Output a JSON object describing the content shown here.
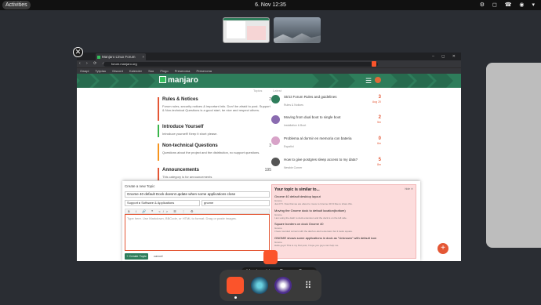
{
  "topbar": {
    "activities": "Activities",
    "clock": "6. Nov  12:35",
    "tray": "⚙ ◻ ☎ ◉ ▾"
  },
  "browser": {
    "tab_title": "Manjaro Linux Forum",
    "tab_close": "×",
    "url": "forum.manjaro.org",
    "nav_icons": "‹ › ⟳ ⌂",
    "window_controls": "– ◻ ✕",
    "bookmarks": [
      "Owapi",
      "Tylydau",
      "Discord",
      "Kalender",
      "Soo",
      "Pingo",
      "Preseroma",
      "Preseroma"
    ]
  },
  "forum": {
    "logo": "manjaro",
    "hamburger": "☰",
    "col_topics": "Topics",
    "col_latest": "Latest",
    "categories": [
      {
        "title": "Rules & Notices",
        "desc": "Forum rules, security notices & important info. Don't be afraid to post. Support & Non-technical Questions is a good start, be nice and respect others.",
        "count": "2",
        "color": "#e45735"
      },
      {
        "title": "Introduce Yourself",
        "desc": "Introduce yourself! Keep it short please.",
        "count": "",
        "color": "#3ab54a"
      },
      {
        "title": "Non-technical Questions",
        "desc": "Questions about the project and the distribution, no support questions.",
        "count": "3",
        "color": "#f7941d"
      },
      {
        "title": "Announcements",
        "desc": "This category is for announcements",
        "count": "195",
        "color": "#e45735"
      }
    ],
    "latest": [
      {
        "title": "Strict Forum Rules and guidelines",
        "cat": "Rules & Notices",
        "replies": "3",
        "age": "Aug 20",
        "avatar": "#2e7d5b"
      },
      {
        "title": "Moving from dual boot to single boot",
        "cat": "Installation & Boot",
        "replies": "2",
        "age": "5m",
        "avatar": "#8a6bb0"
      },
      {
        "title": "Problema al dormir en memoria con bateria",
        "cat": "Español",
        "replies": "0",
        "age": "6m",
        "avatar": "#d8a3c8"
      },
      {
        "title": "How to give postgres sleep access to my data?",
        "cat": "Newbie Corner",
        "replies": "5",
        "age": "8m",
        "avatar": "#555555"
      }
    ]
  },
  "composer": {
    "header": "Create a new Topic",
    "title_value": "Gnome 40 default Dock doesnt update when some applications close",
    "category": "Support  ▸ Software & Applications",
    "tag": "gnome",
    "toolbar": "B I 🔗 ❝ </> ☰ ⋮ ⚙",
    "placeholder": "Type here. Use Markdown, BBCode, or HTML to format. Drag or paste images.",
    "create_label": "+ Create Topic",
    "cancel_label": "cancel"
  },
  "similar": {
    "title": "Your topic is similar to...",
    "hide": "hide ✕",
    "items": [
      {
        "title": "Gnome 40 default desktop layout",
        "cat": "Gnome",
        "excerpt": "Just FYI. Now that we are about to move to Gnome 40 I'd like to share this."
      },
      {
        "title": "Moving the Gnome dock to default location(bottom)",
        "cat": "Gnome",
        "excerpt": "I am using the dash to dock extension and the dock is on the left side."
      },
      {
        "title": "Square borders on dock Gnome 40",
        "cat": "Gnome",
        "excerpt": "I have rounded corners with the dash-to-dock extension but it looks square."
      },
      {
        "title": "GNOME shows some applications in dock as \"Unknown\" with default icon",
        "cat": "Gnome",
        "excerpt": "Hello guys! This is my first post, I hope you guys can help me."
      }
    ]
  },
  "fab": "+",
  "dock": {
    "caption": "Manjaro Linux Forum - Brave",
    "grid": "⠿"
  }
}
